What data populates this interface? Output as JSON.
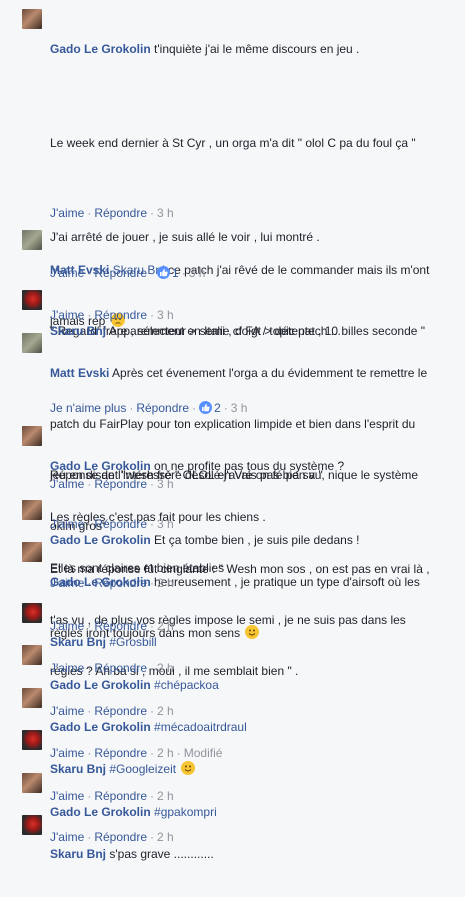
{
  "actions": {
    "like": "J'aime",
    "unlike": "Je n'aime plus",
    "reply": "Répondre",
    "modified": "Modifié"
  },
  "comments": [
    {
      "author": "Gado Le Grokolin",
      "text_lines": [
        "t'inquiète j'ai le même discours en jeu .",
        "Le week end dernier à St Cyr , un orga m'a dit \" olol C pa du foul ça \"",
        "J'ai arrêté de jouer , je suis allé le voir , lui montré .",
        "\" Regard' frère , sélecteur > semi , doigt > détente , 10 billes seconde \"",
        "Réponse de l'intéressé \" OLOL en Vré on fé pa sa \"",
        "Et là ma réponse fût cinglante : \" Wesh mon sos , on est pas en vrai là ,",
        "t'as vu , de plus vos règles impose le semi , je ne suis pas dans les",
        "règles ? Ah ba si , moui , il me semblait bien \" ."
      ],
      "time": "3 h"
    },
    {
      "author": "Matt Evski",
      "mention": "Skaru Bnj",
      "text_lines": [
        "ce patch j'ai rêvé de le commander mais ils m'ont",
        "jamais rep"
      ],
      "likes": "1",
      "time": "3 h"
    },
    {
      "author": "Skaru Bnj",
      "text_lines": [
        "Apparemment en Italie cf FA / topic patch ..."
      ],
      "time": "3 h"
    },
    {
      "author": "Matt Evski",
      "text_lines": [
        "Après cet évenement l'orga a du évidemment te remettre le",
        "patch du FairPlay pour ton explication limpide et bien dans l'esprit du",
        "jeu en disant \"wesh frère désolé j'avais pas bien vu, nique le système",
        "oklm gros\""
      ],
      "likes": "2",
      "time": "3 h"
    },
    {
      "author": "Gado Le Grokolin",
      "text_lines": [
        "on ne profite pas tous du système ?",
        "Les règles c'est pas fait pour les chiens .",
        "Elles sont claires et bien établies ."
      ],
      "time": "3 h"
    },
    {
      "author": "Gado Le Grokolin",
      "text_lines": [
        "Et ça tombe bien , je suis pile dedans !"
      ],
      "time": "3 h"
    },
    {
      "author": "Gado Le Grokolin",
      "text_lines": [
        "heureusement , je pratique un type d'airsoft où les",
        "règles iront toujours dans mon sens"
      ],
      "time": "2 h"
    },
    {
      "author": "Skaru Bnj",
      "text_lines": [
        "#Grosbill"
      ],
      "time": "2 h"
    },
    {
      "author": "Gado Le Grokolin",
      "text_lines": [
        "#chépackoa"
      ],
      "time": "2 h"
    },
    {
      "author": "Gado Le Grokolin",
      "text_lines": [
        "#mécadoaitrdraul"
      ],
      "time": "2 h"
    },
    {
      "author": "Skaru Bnj",
      "text_lines": [
        "#Googleizeit"
      ],
      "time": "2 h"
    },
    {
      "author": "Gado Le Grokolin",
      "text_lines": [
        "#gpakompri"
      ],
      "time": "2 h"
    },
    {
      "author": "Skaru Bnj",
      "text_lines": [
        "s'pas grave ............"
      ],
      "time": "2 h"
    }
  ]
}
